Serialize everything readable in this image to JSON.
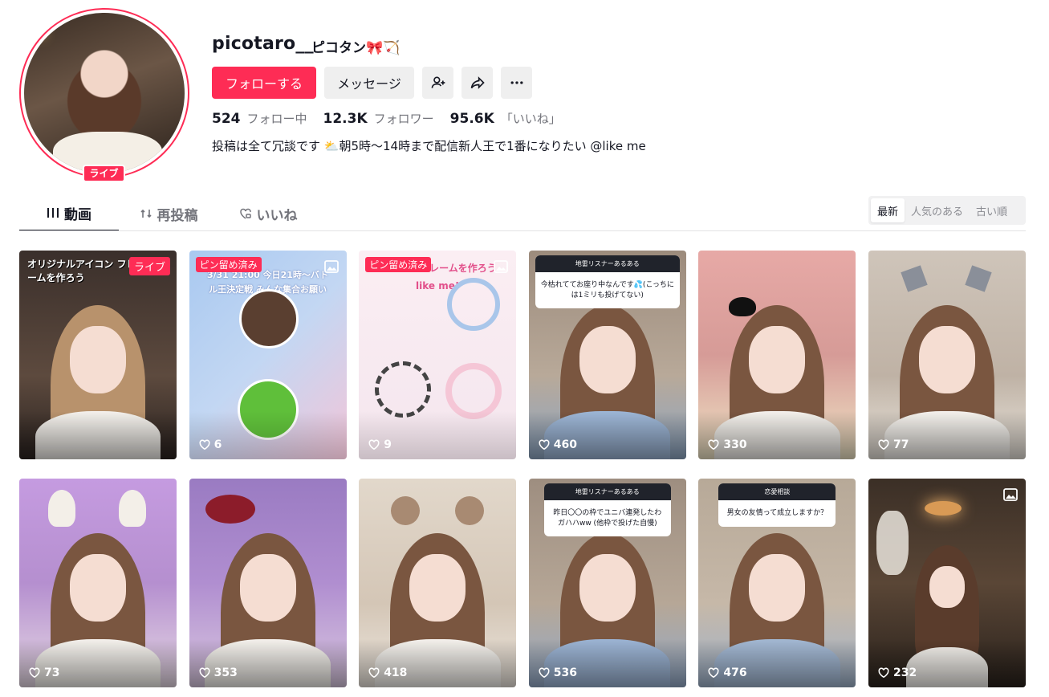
{
  "profile": {
    "username": "picotaro__",
    "nickname": "ピコタン🎀🏹",
    "live_badge": "ライブ",
    "bio": "投稿は全て冗談です ⛅朝5時〜14時まで配信新人王で1番になりたい @like me"
  },
  "actions": {
    "follow_label": "フォローする",
    "message_label": "メッセージ"
  },
  "stats": {
    "following_count": "524",
    "following_label": "フォロー中",
    "followers_count": "12.3K",
    "followers_label": "フォロワー",
    "likes_count": "95.6K",
    "likes_label": "「いいね」"
  },
  "tabs": [
    {
      "label": "動画",
      "icon": "grid-icon"
    },
    {
      "label": "再投稿",
      "icon": "repost-icon"
    },
    {
      "label": "いいね",
      "icon": "heart-lock-icon"
    }
  ],
  "sort": {
    "options": [
      "最新",
      "人気のある",
      "古い順"
    ],
    "selected": "最新"
  },
  "videos": [
    {
      "views": "",
      "tag": "ライブ",
      "overlay": "オリジナルアイコン フレームを作ろう",
      "bg": "#3b2a2a"
    },
    {
      "views": "6",
      "tag": "ピン留め済み",
      "overlay": "3/31 21:00 今日21時〜バトル王決定戦 みんな集合お願いします",
      "bg": "#9fc3ec"
    },
    {
      "views": "9",
      "tag": "ピン留め済み",
      "overlay": "アイコン フレームを作ろう like me!",
      "bg": "#f4e9ef"
    },
    {
      "views": "460",
      "question_header": "地雷リスナーあるある",
      "question": "今枯れててお座り中なんです💦(こっちには1ミリも投げてない)",
      "bg": "#b5a79a"
    },
    {
      "views": "330",
      "bg": "#d9a9a4"
    },
    {
      "views": "77",
      "bg": "#c9bdb2"
    },
    {
      "views": "73",
      "bg": "#b98fc9"
    },
    {
      "views": "353",
      "bg": "#a889c6"
    },
    {
      "views": "418",
      "bg": "#d8cdbf"
    },
    {
      "views": "536",
      "question_header": "地雷リスナーあるある",
      "question": "昨日〇〇の枠でユニバ連発したわ ガハハww (他枠で投げた自慢)",
      "bg": "#b7aa9d"
    },
    {
      "views": "476",
      "question_header": "恋愛相談",
      "question": "男女の友情って成立しますか？",
      "bg": "#c2b6a8"
    },
    {
      "views": "232",
      "bg": "#3a2e25"
    }
  ],
  "colors": {
    "accent": "#fe2c55",
    "text_secondary": "#73747b"
  }
}
